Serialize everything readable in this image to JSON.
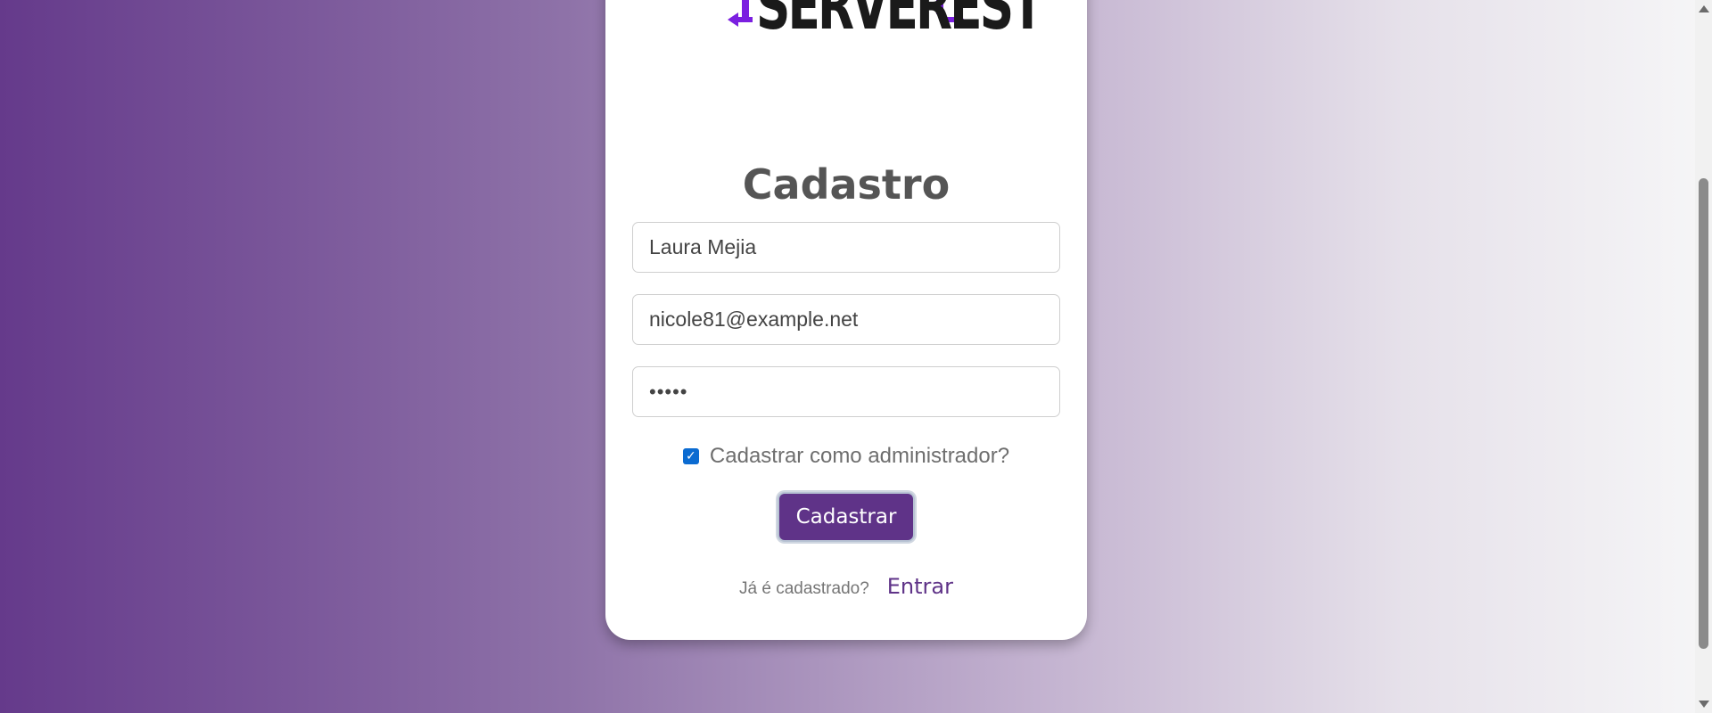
{
  "brand": {
    "logo_text": "SERVEREST",
    "accent": "#7b1fe0"
  },
  "form": {
    "title": "Cadastro",
    "name_value": "Laura Mejia",
    "email_value": "nicole81@example.net",
    "password_value": "•••••",
    "admin_checkbox": {
      "label": "Cadastrar como administrador?",
      "checked": true
    },
    "submit_label": "Cadastrar",
    "login_prompt": "Já é cadastrado?",
    "login_link": "Entrar"
  },
  "colors": {
    "primary": "#5f3388",
    "checkbox": "#0b6bd1",
    "background_start": "#653a8b",
    "background_end": "#f6f6f7"
  }
}
